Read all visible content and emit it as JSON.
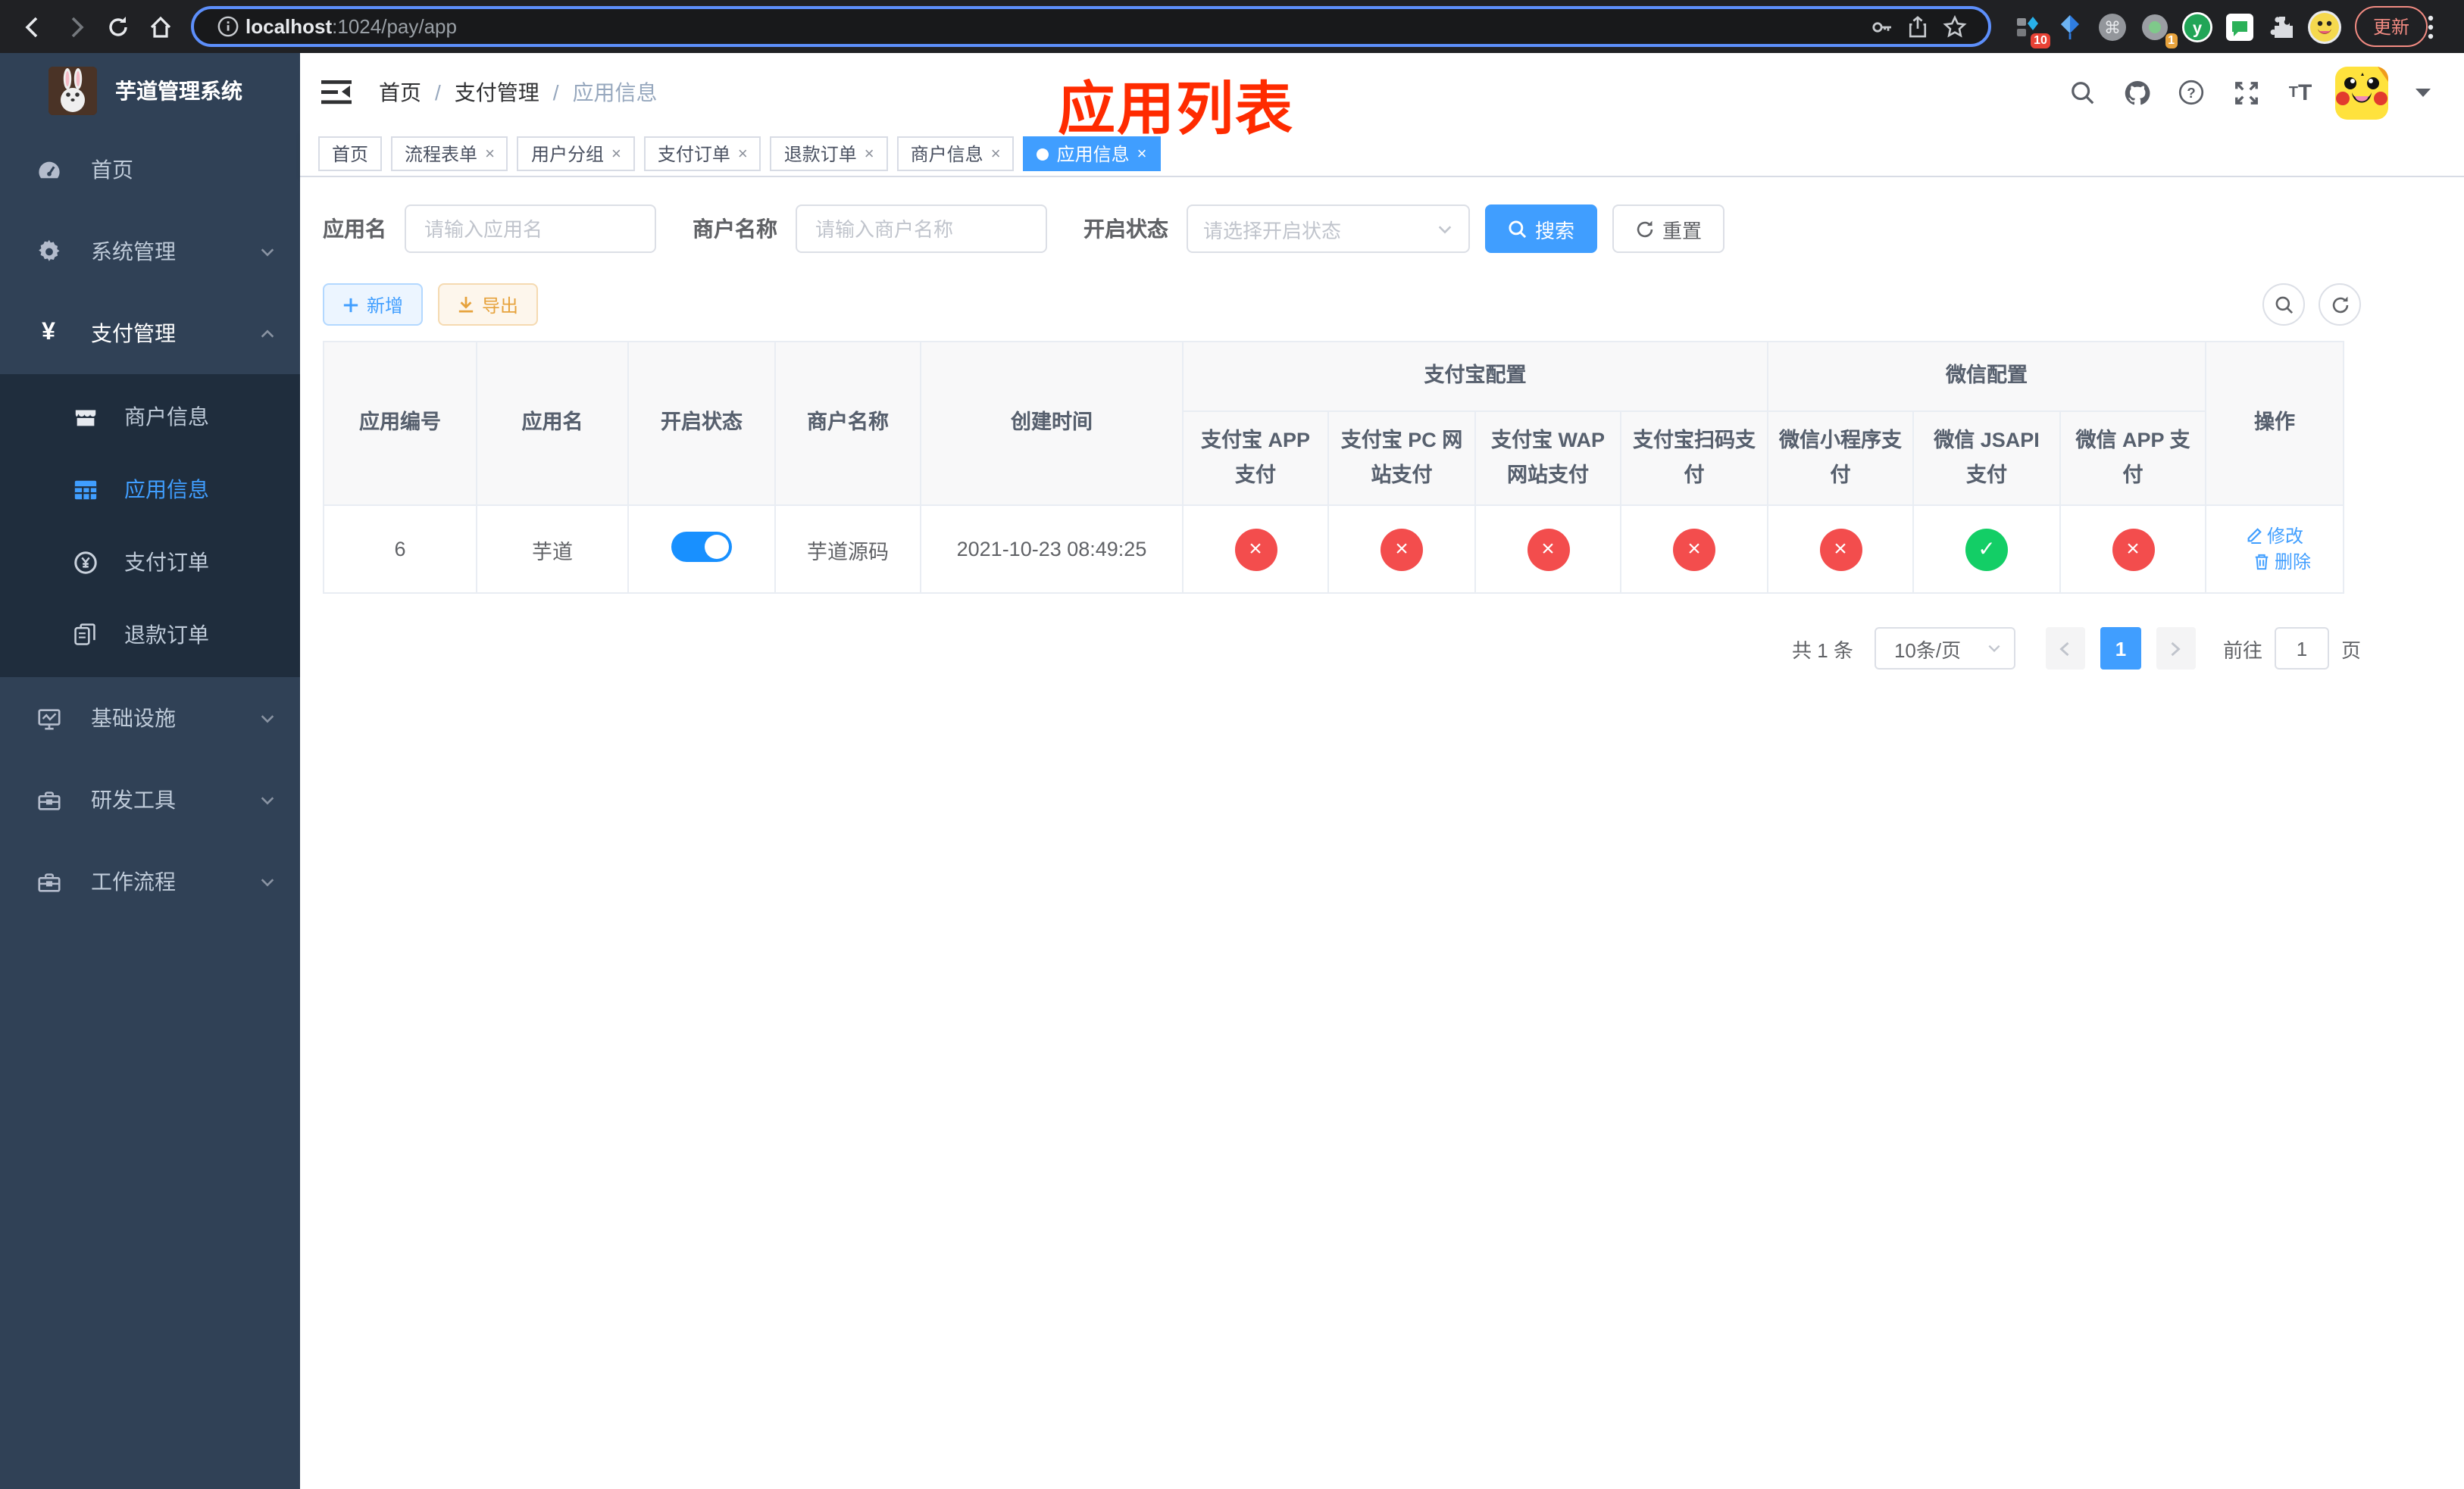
{
  "ui": {
    "close_glyph": "×",
    "crumb_sep": "/"
  },
  "browser": {
    "url_host": "localhost",
    "url_path": ":1024/pay/app",
    "update_label": "更新",
    "ext_badge_blocks": "10",
    "ext_badge_camera": "1",
    "ext_y_letter": "y",
    "ext_cmd_glyph": "⌘"
  },
  "sidebar": {
    "title": "芋道管理系统",
    "menu_top": [
      {
        "label": "首页",
        "icon": "dashboard-icon"
      },
      {
        "label": "系统管理",
        "icon": "gear-icon"
      },
      {
        "label": "支付管理",
        "icon": "yen-icon"
      }
    ],
    "submenu": [
      {
        "label": "商户信息"
      },
      {
        "label": "应用信息"
      },
      {
        "label": "支付订单"
      },
      {
        "label": "退款订单"
      }
    ],
    "menu_bottom": [
      {
        "label": "基础设施"
      },
      {
        "label": "研发工具"
      },
      {
        "label": "工作流程"
      }
    ],
    "yen_glyph": "¥"
  },
  "header": {
    "breadcrumb": [
      "首页",
      "支付管理",
      "应用信息"
    ],
    "annotation": "应用列表"
  },
  "tabs": [
    {
      "label": "首页"
    },
    {
      "label": "流程表单"
    },
    {
      "label": "用户分组"
    },
    {
      "label": "支付订单"
    },
    {
      "label": "退款订单"
    },
    {
      "label": "商户信息"
    },
    {
      "label": "应用信息"
    }
  ],
  "filters": {
    "app_name_label": "应用名",
    "app_name_placeholder": "请输入应用名",
    "merchant_label": "商户名称",
    "merchant_placeholder": "请输入商户名称",
    "status_label": "开启状态",
    "status_placeholder": "请选择开启状态",
    "search_label": "搜索",
    "reset_label": "重置"
  },
  "toolbar": {
    "add_label": "新增",
    "export_label": "导出"
  },
  "table": {
    "columns": [
      "应用编号",
      "应用名",
      "开启状态",
      "商户名称",
      "创建时间"
    ],
    "group_alipay": "支付宝配置",
    "group_wechat": "微信配置",
    "sub_columns": [
      "支付宝 APP 支付",
      "支付宝 PC 网站支付",
      "支付宝 WAP 网站支付",
      "支付宝扫码支付",
      "微信小程序支付",
      "微信 JSAPI 支付",
      "微信 APP 支付"
    ],
    "ops_column": "操作",
    "rows": [
      {
        "id": "6",
        "name": "芋道",
        "toggle_class": "on",
        "merchant": "芋道源码",
        "created": "2021-10-23 08:49:25",
        "statuses": [
          "no",
          "no",
          "no",
          "no",
          "no",
          "yes",
          "no"
        ],
        "op_edit": "修改",
        "op_delete": "删除"
      }
    ]
  },
  "pagination": {
    "total": "共 1 条",
    "page_size": "10条/页",
    "page": "1",
    "goto_label": "前往",
    "goto_value": "1",
    "page_unit": "页"
  }
}
